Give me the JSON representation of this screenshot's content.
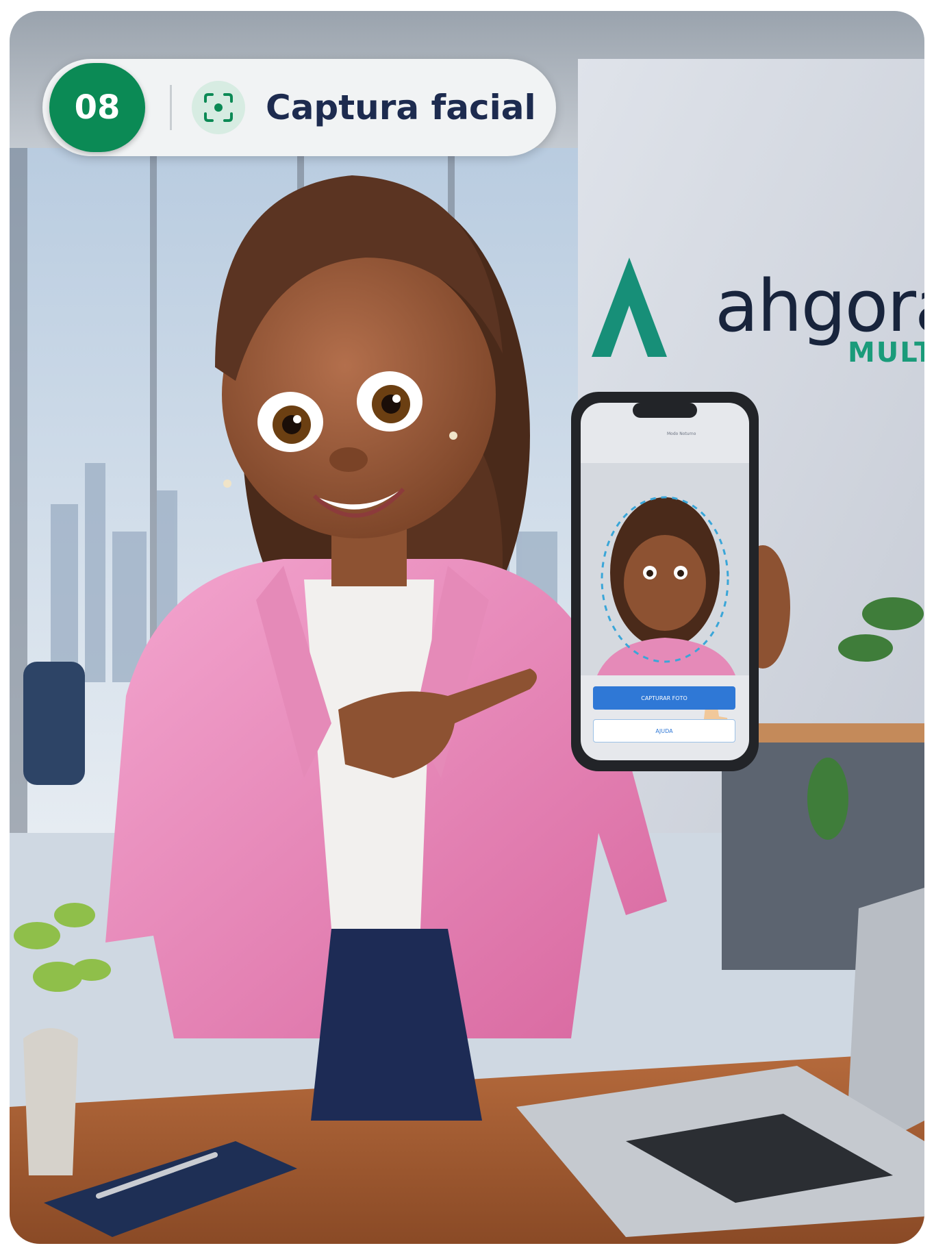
{
  "badge": {
    "step": "08",
    "title": "Captura facial",
    "icon": "face-scan-icon"
  },
  "brand": {
    "logo_text": "ahgora",
    "logo_sub": "MULTI",
    "colors": {
      "green": "#0b8a55",
      "teal": "#1a9b7a",
      "navy": "#1d2b4f"
    }
  },
  "phone": {
    "status_text": "Modo Noturno",
    "primary_button": "CAPTURAR FOTO",
    "secondary_button": "AJUDA"
  }
}
